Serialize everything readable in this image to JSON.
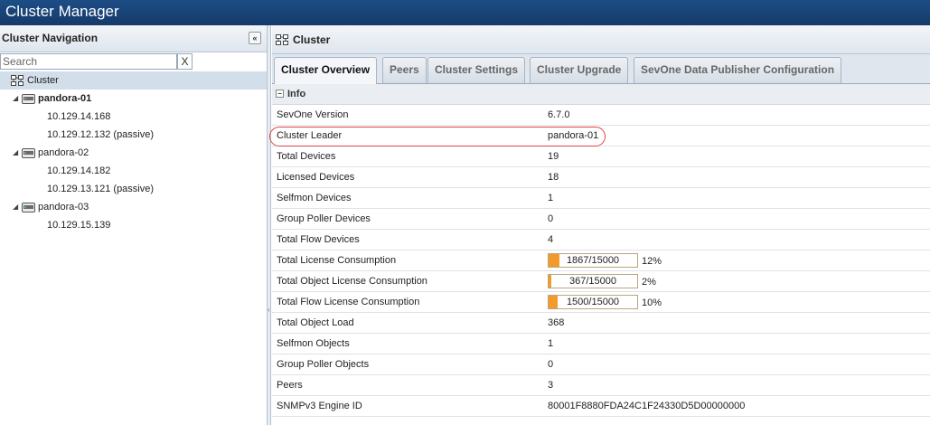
{
  "app": {
    "title": "Cluster Manager"
  },
  "nav": {
    "header": "Cluster Navigation",
    "collapse_icon": "«",
    "search_placeholder": "Search",
    "search_clear": "X",
    "root_label": "Cluster",
    "nodes": [
      {
        "label": "pandora-01",
        "bold": true,
        "ips": [
          "10.129.14.168",
          "10.129.12.132 (passive)"
        ]
      },
      {
        "label": "pandora-02",
        "bold": false,
        "ips": [
          "10.129.14.182",
          "10.129.13.121 (passive)"
        ]
      },
      {
        "label": "pandora-03",
        "bold": false,
        "ips": [
          "10.129.15.139"
        ]
      }
    ]
  },
  "main": {
    "title": "Cluster",
    "tabs": [
      {
        "label": "Cluster Overview",
        "active": true
      },
      {
        "label": "Peers",
        "active": false
      },
      {
        "label": "Cluster Settings",
        "active": false
      },
      {
        "label": "Cluster Upgrade",
        "active": false
      },
      {
        "label": "SevOne Data Publisher Configuration",
        "active": false
      }
    ],
    "section": {
      "toggle": "−",
      "title": "Info"
    },
    "rows": [
      {
        "label": "SevOne Version",
        "value": "6.7.0"
      },
      {
        "label": "Cluster Leader",
        "value": "pandora-01",
        "highlighted": true
      },
      {
        "label": "Total Devices",
        "value": "19"
      },
      {
        "label": "Licensed Devices",
        "value": "18"
      },
      {
        "label": "Selfmon Devices",
        "value": "1"
      },
      {
        "label": "Group Poller Devices",
        "value": "0"
      },
      {
        "label": "Total Flow Devices",
        "value": "4"
      },
      {
        "label": "Total License Consumption",
        "bar_text": "1867/15000",
        "fill": 0.12,
        "percent": "12%"
      },
      {
        "label": "Total Object License Consumption",
        "bar_text": "367/15000",
        "fill": 0.02,
        "percent": "2%"
      },
      {
        "label": "Total Flow License Consumption",
        "bar_text": "1500/15000",
        "fill": 0.1,
        "percent": "10%"
      },
      {
        "label": "Total Object Load",
        "value": "368"
      },
      {
        "label": "Selfmon Objects",
        "value": "1"
      },
      {
        "label": "Group Poller Objects",
        "value": "0"
      },
      {
        "label": "Peers",
        "value": "3"
      },
      {
        "label": "SNMPv3 Engine ID",
        "value": "80001F8880FDA24C1F24330D5D00000000"
      }
    ]
  },
  "colors": {
    "titlebar": "#1a4478",
    "bar_fill": "#f39a2c",
    "highlight_oval": "#e04545",
    "selected_row": "#d3deeb"
  }
}
